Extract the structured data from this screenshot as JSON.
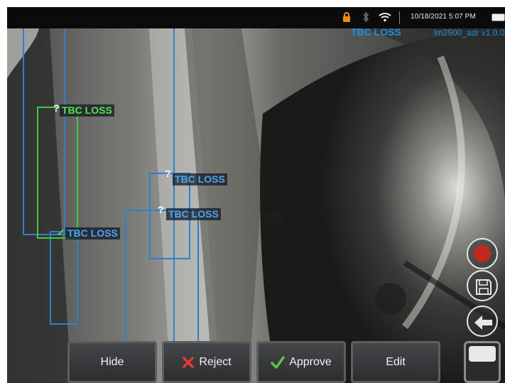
{
  "status_bar": {
    "icons": [
      "lock-icon",
      "bluetooth-icon",
      "wifi-icon",
      "battery-icon"
    ],
    "datetime": "10/18/2021 5:07 PM"
  },
  "hud": {
    "top_tag": "TBC LOSS",
    "version": "lm2500_adr v1.0.0"
  },
  "detections": [
    {
      "label": "TBC LOSS",
      "marker": "?",
      "color": "#42c83c"
    },
    {
      "label": "TBC LOSS",
      "marker": "",
      "color": "#2f7fd0"
    },
    {
      "label": "TBC LOSS",
      "marker": "?",
      "color": "#2f7fd0"
    },
    {
      "label": "TBC LOSS",
      "marker": "?",
      "color": "#2f7fd0"
    }
  ],
  "side_buttons": [
    "record-icon",
    "save-icon",
    "back-arrow-icon"
  ],
  "action_bar": {
    "hide": "Hide",
    "reject": "Reject",
    "approve": "Approve",
    "edit": "Edit"
  },
  "colors": {
    "blue_box": "#2f7fd0",
    "green_box": "#42c83c",
    "record": "#c2281f",
    "reject_x": "#e8392c",
    "approve_check": "#5ec43c"
  }
}
